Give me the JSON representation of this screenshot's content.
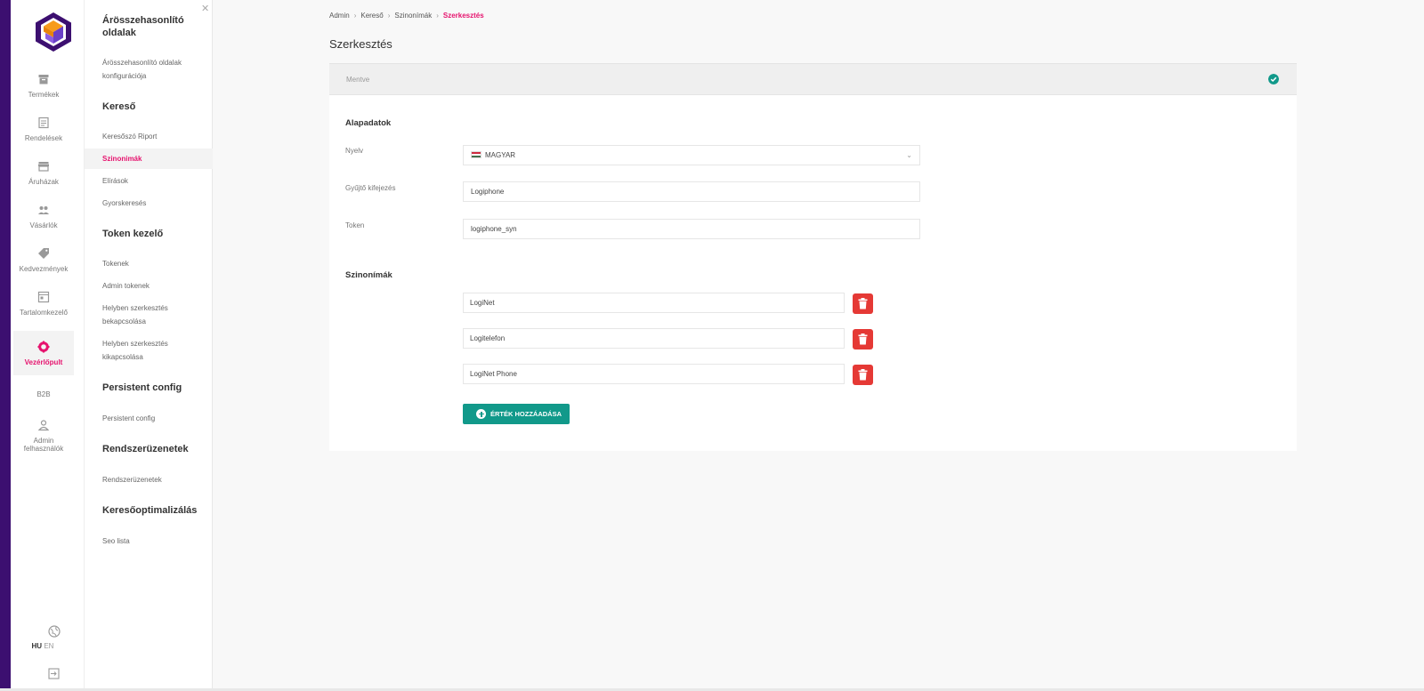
{
  "colors": {
    "accent": "#e6136e",
    "primary": "#11998a",
    "danger": "#e53935",
    "stripe": "#3c0f70"
  },
  "rail": {
    "items": [
      {
        "label": "Termékek",
        "icon": "archive-icon"
      },
      {
        "label": "Rendelések",
        "icon": "receipt-icon"
      },
      {
        "label": "Áruházak",
        "icon": "store-icon"
      },
      {
        "label": "Vásárlók",
        "icon": "people-icon"
      },
      {
        "label": "Kedvezmények",
        "icon": "tag-icon"
      },
      {
        "label": "Tartalomkezelő",
        "icon": "content-icon"
      },
      {
        "label": "Vezérlőpult",
        "icon": "gear-icon",
        "active": true
      },
      {
        "label": "B2B"
      },
      {
        "label": "Admin felhasználók",
        "icon": "user-icon"
      }
    ],
    "lang_hu": "HU",
    "lang_en": "EN"
  },
  "submenu": {
    "sections": [
      {
        "title": "Árösszehasonlító oldalak",
        "links": [
          "Árösszehasonlító oldalak konfigurációja"
        ]
      },
      {
        "title": "Kereső",
        "links": [
          "Keresőszó Riport",
          "Szinonimák",
          "Elírások",
          "Gyorskeresés"
        ]
      },
      {
        "title": "Token kezelő",
        "links": [
          "Tokenek",
          "Admin tokenek",
          "Helyben szerkesztés bekapcsolása",
          "Helyben szerkesztés kikapcsolása"
        ]
      },
      {
        "title": "Persistent config",
        "links": [
          "Persistent config"
        ]
      },
      {
        "title": "Rendszerüzenetek",
        "links": [
          "Rendszerüzenetek"
        ]
      },
      {
        "title": "Keresőoptimalizálás",
        "links": [
          "Seo lista"
        ]
      }
    ]
  },
  "breadcrumb": [
    "Admin",
    "Kereső",
    "Szinonímák",
    "Szerkesztés"
  ],
  "page_title": "Szerkesztés",
  "status": "Mentve",
  "form": {
    "basic_title": "Alapadatok",
    "language_label": "Nyelv",
    "language_value": "MAGYAR",
    "collector_label": "Gyűjtő kifejezés",
    "collector_value": "Logiphone",
    "token_label": "Token",
    "token_value": "logiphone_syn",
    "synonyms_title": "Szinonímák",
    "synonyms": [
      "LogiNet",
      "Logitelefon",
      "LogiNet Phone"
    ],
    "add_button": "ÉRTÉK HOZZÁADÁSA"
  }
}
